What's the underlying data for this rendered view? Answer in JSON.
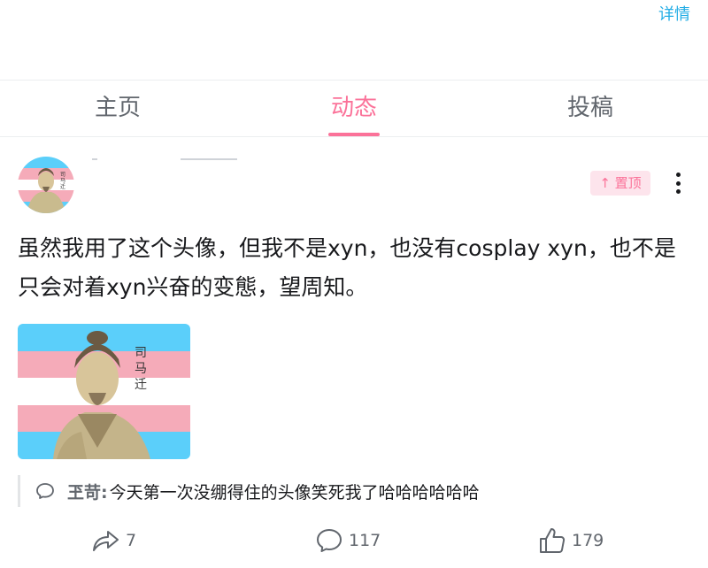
{
  "header": {
    "details_label": "详情"
  },
  "tabs": [
    {
      "label": "主页",
      "active": false
    },
    {
      "label": "动态",
      "active": true
    },
    {
      "label": "投稿",
      "active": false
    }
  ],
  "post": {
    "pinned_label": "置顶",
    "text": "虽然我用了这个头像，但我不是xyn，也没有cosplay xyn，也不是只会对着xyn兴奋的变態，望周知。",
    "image_caption": "司马迁"
  },
  "comment": {
    "author": "玊苛:",
    "text": " 今天第一次没绷得住的头像笑死我了哈哈哈哈哈哈"
  },
  "actions": {
    "share_count": "7",
    "comment_count": "117",
    "like_count": "179"
  },
  "colors": {
    "accent": "#fb7299",
    "link": "#23ade5",
    "trans_blue": "#5bcffa",
    "trans_pink": "#f5abb9"
  }
}
